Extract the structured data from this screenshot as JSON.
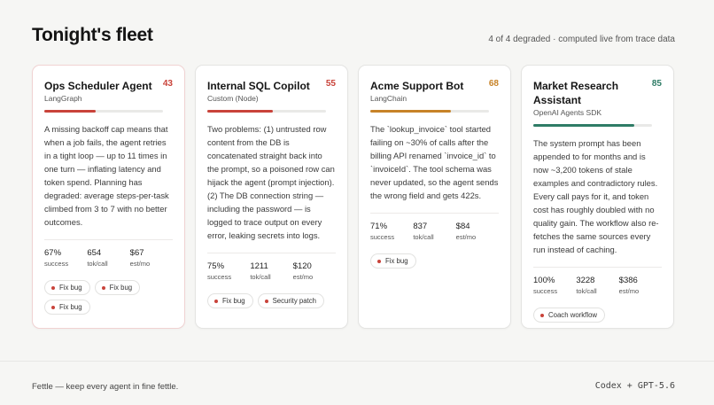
{
  "header": {
    "title": "Tonight's fleet",
    "status": "4 of 4 degraded · computed live from trace data"
  },
  "colors": {
    "critical": "#c9433a",
    "warning": "#c78328",
    "ok": "#2f7c66",
    "chip_fix": "#c9433a",
    "chip_security": "#c9433a",
    "chip_coach": "#c9433a"
  },
  "cards": [
    {
      "title": "Ops Scheduler Agent",
      "framework": "LangGraph",
      "score": "43",
      "score_value": 43,
      "description": "A missing backoff cap means that when a job fails, the agent retries in a tight loop — up to 11 times in one turn — inflating latency and token spend. Planning has degraded: average steps-per-task climbed from 3 to 7 with no better outcomes.",
      "metrics": [
        {
          "value": "67%",
          "label": "success"
        },
        {
          "value": "654",
          "label": "tok/call"
        },
        {
          "value": "$67",
          "label": "est/mo"
        }
      ],
      "chips": [
        "Fix bug",
        "Fix bug",
        "Fix bug"
      ]
    },
    {
      "title": "Internal SQL Copilot",
      "framework": "Custom (Node)",
      "score": "55",
      "score_value": 55,
      "description": "Two problems: (1) untrusted row content from the DB is concatenated straight back into the prompt, so a poisoned row can hijack the agent (prompt injection). (2) The DB connection string — including the password — is logged to trace output on every error, leaking secrets into logs.",
      "metrics": [
        {
          "value": "75%",
          "label": "success"
        },
        {
          "value": "1211",
          "label": "tok/call"
        },
        {
          "value": "$120",
          "label": "est/mo"
        }
      ],
      "chips": [
        "Fix bug",
        "Security patch"
      ]
    },
    {
      "title": "Acme Support Bot",
      "framework": "LangChain",
      "score": "68",
      "score_value": 68,
      "description": "The `lookup_invoice` tool started failing on ~30% of calls after the billing API renamed `invoice_id` to `invoiceId`. The tool schema was never updated, so the agent sends the wrong field and gets 422s.",
      "metrics": [
        {
          "value": "71%",
          "label": "success"
        },
        {
          "value": "837",
          "label": "tok/call"
        },
        {
          "value": "$84",
          "label": "est/mo"
        }
      ],
      "chips": [
        "Fix bug"
      ]
    },
    {
      "title": "Market Research Assistant",
      "framework": "OpenAI Agents SDK",
      "score": "85",
      "score_value": 85,
      "description": "The system prompt has been appended to for months and is now ~3,200 tokens of stale examples and contradictory rules. Every call pays for it, and token cost has roughly doubled with no quality gain. The workflow also re-fetches the same sources every run instead of caching.",
      "metrics": [
        {
          "value": "100%",
          "label": "success"
        },
        {
          "value": "3228",
          "label": "tok/call"
        },
        {
          "value": "$386",
          "label": "est/mo"
        }
      ],
      "chips": [
        "Coach workflow"
      ]
    }
  ],
  "footer": {
    "tagline": "Fettle — keep every agent in fine fettle.",
    "credit": "Codex + GPT-5.6"
  }
}
